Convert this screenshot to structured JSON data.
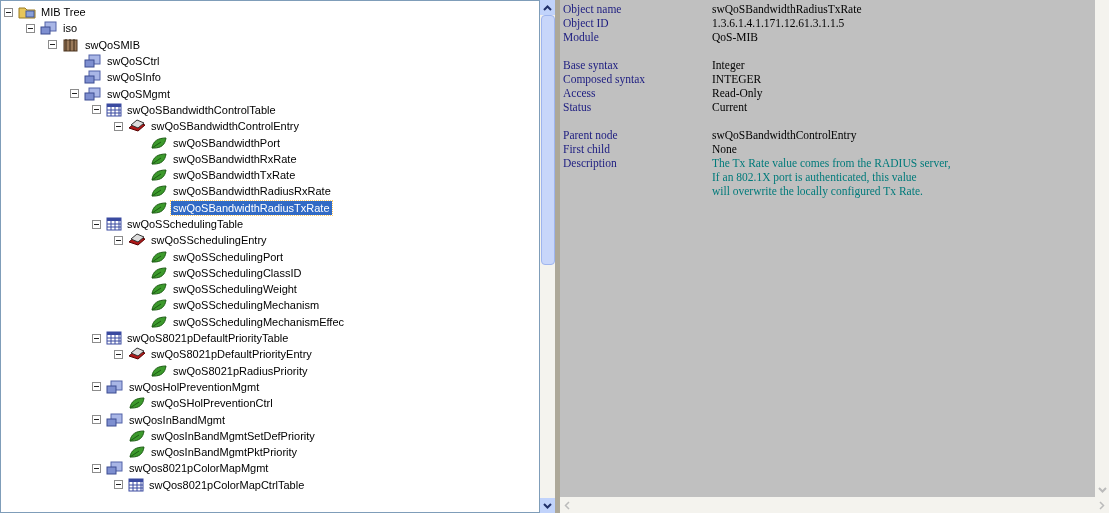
{
  "tree": [
    {
      "label": "MIB Tree",
      "kind": "root",
      "expanded": true,
      "selected": false,
      "children": [
        {
          "label": "iso",
          "kind": "group",
          "expanded": true,
          "selected": false,
          "children": [
            {
              "label": "swQoSMIB",
              "kind": "module",
              "expanded": true,
              "selected": false,
              "children": [
                {
                  "label": "swQoSCtrl",
                  "kind": "group",
                  "selected": false
                },
                {
                  "label": "swQoSInfo",
                  "kind": "group",
                  "selected": false
                },
                {
                  "label": "swQoSMgmt",
                  "kind": "group",
                  "expanded": true,
                  "selected": false,
                  "children": [
                    {
                      "label": "swQoSBandwidthControlTable",
                      "kind": "table",
                      "expanded": true,
                      "selected": false,
                      "children": [
                        {
                          "label": "swQoSBandwidthControlEntry",
                          "kind": "entry",
                          "expanded": true,
                          "selected": false,
                          "children": [
                            {
                              "label": "swQoSBandwidthPort",
                              "kind": "leaf",
                              "selected": false
                            },
                            {
                              "label": "swQoSBandwidthRxRate",
                              "kind": "leaf",
                              "selected": false
                            },
                            {
                              "label": "swQoSBandwidthTxRate",
                              "kind": "leaf",
                              "selected": false
                            },
                            {
                              "label": "swQoSBandwidthRadiusRxRate",
                              "kind": "leaf",
                              "selected": false
                            },
                            {
                              "label": "swQoSBandwidthRadiusTxRate",
                              "kind": "leaf",
                              "selected": true
                            }
                          ]
                        }
                      ]
                    },
                    {
                      "label": "swQoSSchedulingTable",
                      "kind": "table",
                      "expanded": true,
                      "selected": false,
                      "children": [
                        {
                          "label": "swQoSSchedulingEntry",
                          "kind": "entry",
                          "expanded": true,
                          "selected": false,
                          "children": [
                            {
                              "label": "swQoSSchedulingPort",
                              "kind": "leaf",
                              "selected": false
                            },
                            {
                              "label": "swQoSSchedulingClassID",
                              "kind": "leaf",
                              "selected": false
                            },
                            {
                              "label": "swQoSSchedulingWeight",
                              "kind": "leaf",
                              "selected": false
                            },
                            {
                              "label": "swQoSSchedulingMechanism",
                              "kind": "leaf",
                              "selected": false
                            },
                            {
                              "label": "swQoSSchedulingMechanismEffec",
                              "kind": "leaf",
                              "selected": false
                            }
                          ]
                        }
                      ]
                    },
                    {
                      "label": "swQoS8021pDefaultPriorityTable",
                      "kind": "table",
                      "expanded": true,
                      "selected": false,
                      "children": [
                        {
                          "label": "swQoS8021pDefaultPriorityEntry",
                          "kind": "entry",
                          "expanded": true,
                          "selected": false,
                          "children": [
                            {
                              "label": "swQoS8021pRadiusPriority",
                              "kind": "leaf",
                              "selected": false
                            }
                          ]
                        }
                      ]
                    },
                    {
                      "label": "swQosHolPreventionMgmt",
                      "kind": "group",
                      "expanded": true,
                      "selected": false,
                      "children": [
                        {
                          "label": "swQoSHolPreventionCtrl",
                          "kind": "leaf",
                          "selected": false
                        }
                      ]
                    },
                    {
                      "label": "swQosInBandMgmt",
                      "kind": "group",
                      "expanded": true,
                      "selected": false,
                      "children": [
                        {
                          "label": "swQosInBandMgmtSetDefPriority",
                          "kind": "leaf",
                          "selected": false
                        },
                        {
                          "label": "swQosInBandMgmtPktPriority",
                          "kind": "leaf",
                          "selected": false
                        }
                      ]
                    },
                    {
                      "label": "swQos8021pColorMapMgmt",
                      "kind": "group",
                      "expanded": true,
                      "selected": false,
                      "children": [
                        {
                          "label": "swQos8021pColorMapCtrlTable",
                          "kind": "table",
                          "expanded": true,
                          "selected": false
                        }
                      ]
                    }
                  ]
                }
              ]
            }
          ]
        }
      ]
    }
  ],
  "detail_groups": [
    [
      {
        "label": "Object name",
        "value": "swQoSBandwidthRadiusTxRate"
      },
      {
        "label": "Object ID",
        "value": "1.3.6.1.4.1.171.12.61.3.1.1.5"
      },
      {
        "label": "Module",
        "value": "QoS-MIB"
      }
    ],
    [
      {
        "label": "Base syntax",
        "value": "Integer"
      },
      {
        "label": "Composed syntax",
        "value": "INTEGER"
      },
      {
        "label": "Access",
        "value": "Read-Only"
      },
      {
        "label": "Status",
        "value": "Current"
      }
    ],
    [
      {
        "label": "Parent node",
        "value": "swQoSBandwidthControlEntry"
      },
      {
        "label": "First child",
        "value": "None"
      },
      {
        "label": "Description",
        "kind": "description",
        "lines": [
          "The Tx Rate value comes from the RADIUS server,",
          "If an 802.1X port is authenticated, this value",
          "will overwrite the locally configured Tx Rate."
        ]
      }
    ]
  ]
}
